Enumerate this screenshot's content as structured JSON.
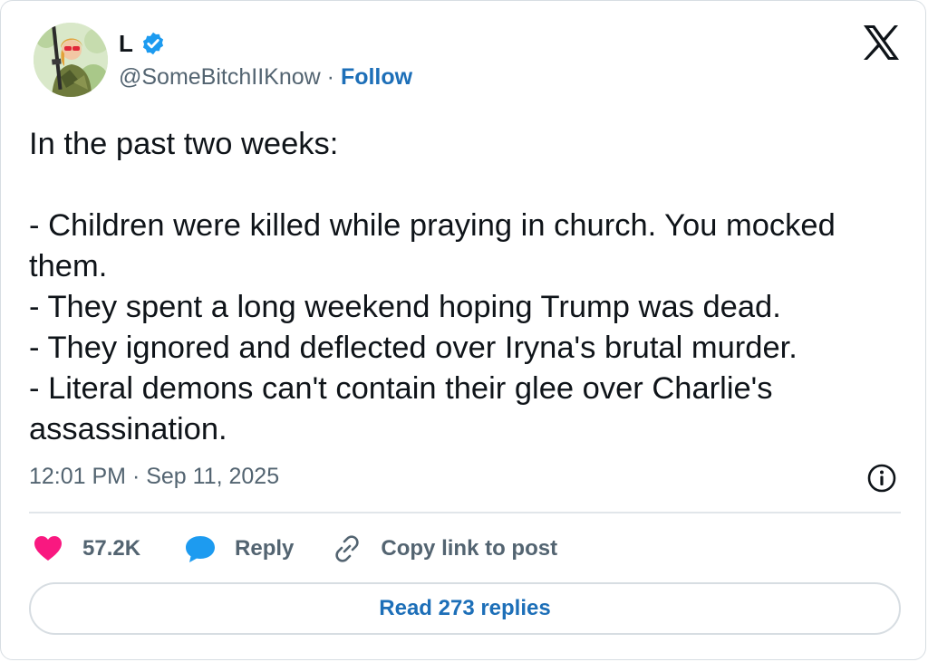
{
  "author": {
    "display_name": "L",
    "handle": "@SomeBitchIIKnow",
    "separator": "·",
    "follow_label": "Follow"
  },
  "tweet": {
    "lines": [
      "In the past two weeks:",
      "",
      "- Children were killed while praying in church. You mocked",
      "them.",
      "- They spent a long weekend hoping Trump was dead.",
      "- They ignored and deflected over Iryna's brutal murder.",
      "- Literal demons can't contain their glee over Charlie's",
      "assassination."
    ],
    "timestamp": "12:01 PM · Sep 11, 2025"
  },
  "actions": {
    "like_count": "57.2K",
    "reply_label": "Reply",
    "copy_label": "Copy link to post"
  },
  "read_replies_label": "Read 273 replies",
  "icons": {
    "brand": "x-logo-icon",
    "verified": "verified-badge-icon",
    "like": "heart-icon",
    "reply": "speech-bubble-icon",
    "copy": "link-icon",
    "info": "info-icon"
  },
  "colors": {
    "link_blue": "#1d6fb8",
    "verified_blue": "#1d9bf0",
    "heart_pink": "#f91880",
    "muted_text": "#536471"
  }
}
